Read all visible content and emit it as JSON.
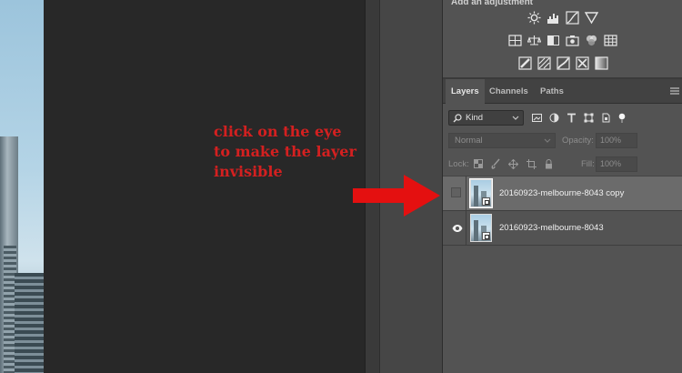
{
  "annotation": {
    "text": "click on the eye\nto make the layer\ninvisible",
    "color": "#d42020"
  },
  "adjustments": {
    "title": "Add an adjustment",
    "row1": [
      "brightness-contrast-icon",
      "levels-icon",
      "curves-icon",
      "exposure-icon"
    ],
    "row2": [
      "vibrance-icon",
      "hue-saturation-icon",
      "color-balance-icon",
      "black-white-icon",
      "photo-filter-icon",
      "channel-mixer-icon",
      "color-lookup-icon"
    ],
    "row3": [
      "invert-icon",
      "posterize-icon",
      "threshold-icon",
      "selective-color-icon",
      "gradient-map-icon"
    ]
  },
  "layers_panel": {
    "tabs": [
      {
        "label": "Layers",
        "active": true
      },
      {
        "label": "Channels",
        "active": false
      },
      {
        "label": "Paths",
        "active": false
      }
    ],
    "filter": {
      "kind_label": "Kind"
    },
    "blend_mode": "Normal",
    "opacity_label": "Opacity:",
    "opacity_value": "100%",
    "lock_label": "Lock:",
    "fill_label": "Fill:",
    "fill_value": "100%",
    "layers": [
      {
        "name": "20160923-melbourne-8043 copy",
        "visible": false,
        "selected": true
      },
      {
        "name": "20160923-melbourne-8043",
        "visible": true,
        "selected": false
      }
    ]
  },
  "colors": {
    "panel_bg": "#535353",
    "selected_row": "#6b6b6b",
    "arrow": "#e41010"
  }
}
